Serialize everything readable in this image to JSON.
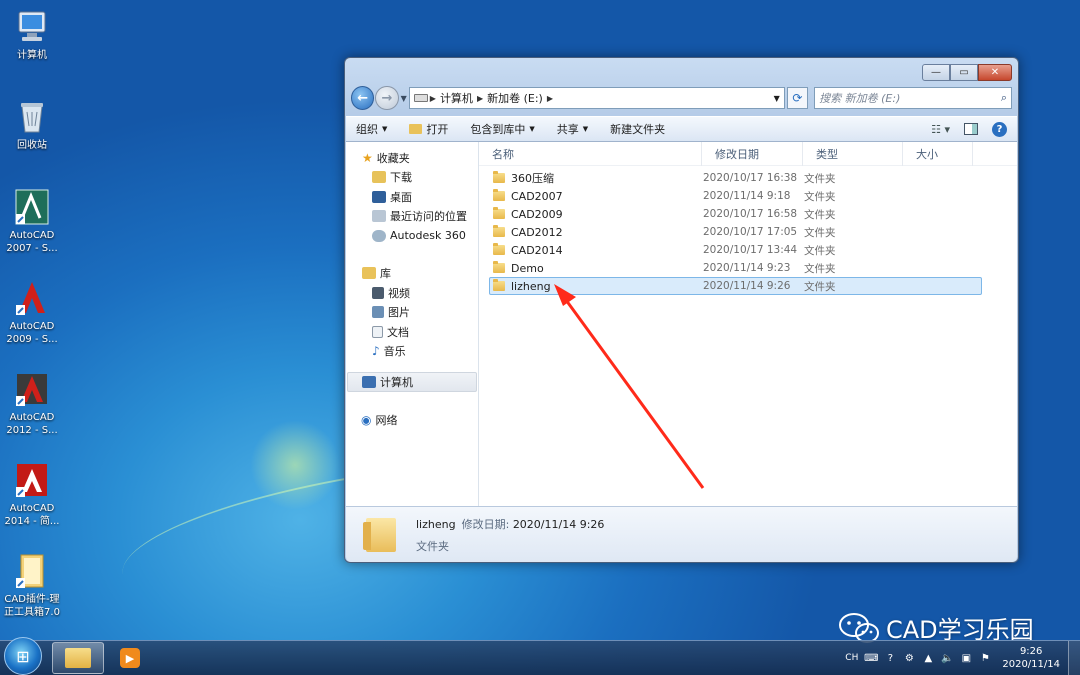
{
  "desktop": {
    "icons": [
      {
        "label": "计算机",
        "icon": "computer-icon"
      },
      {
        "label": "回收站",
        "icon": "recycle-bin-icon"
      },
      {
        "label": "AutoCAD 2007 - S...",
        "icon": "autocad-2007-icon"
      },
      {
        "label": "AutoCAD 2009 - S...",
        "icon": "autocad-2009-icon"
      },
      {
        "label": "AutoCAD 2012 - S...",
        "icon": "autocad-2012-icon"
      },
      {
        "label": "AutoCAD 2014 - 简...",
        "icon": "autocad-2014-icon"
      },
      {
        "label": "CAD插件-理正工具箱7.0",
        "icon": "cad-plugin-icon"
      }
    ]
  },
  "window": {
    "caption": {
      "minimize": "—",
      "maximize": "▭",
      "close": "✕"
    },
    "address": {
      "segments": [
        "计算机",
        "新加卷 (E:)"
      ]
    },
    "search": {
      "placeholder": "搜索 新加卷 (E:)"
    },
    "toolbar": {
      "organize": "组织",
      "open": "打开",
      "include": "包含到库中",
      "share": "共享",
      "new_folder": "新建文件夹"
    },
    "nav": {
      "favorites": "收藏夹",
      "favorites_items": [
        "下载",
        "桌面",
        "最近访问的位置",
        "Autodesk 360"
      ],
      "libraries": "库",
      "libraries_items": [
        "视频",
        "图片",
        "文档",
        "音乐"
      ],
      "computer": "计算机",
      "network": "网络"
    },
    "columns": {
      "name": "名称",
      "date": "修改日期",
      "type": "类型",
      "size": "大小"
    },
    "files": [
      {
        "name": "360压缩",
        "date": "2020/10/17 16:38",
        "type": "文件夹"
      },
      {
        "name": "CAD2007",
        "date": "2020/11/14 9:18",
        "type": "文件夹"
      },
      {
        "name": "CAD2009",
        "date": "2020/10/17 16:58",
        "type": "文件夹"
      },
      {
        "name": "CAD2012",
        "date": "2020/10/17 17:05",
        "type": "文件夹"
      },
      {
        "name": "CAD2014",
        "date": "2020/10/17 13:44",
        "type": "文件夹"
      },
      {
        "name": "Demo",
        "date": "2020/11/14 9:23",
        "type": "文件夹"
      },
      {
        "name": "lizheng",
        "date": "2020/11/14 9:26",
        "type": "文件夹",
        "selected": true
      }
    ],
    "details": {
      "name": "lizheng",
      "date_label": "修改日期:",
      "date": "2020/11/14 9:26",
      "type": "文件夹"
    }
  },
  "taskbar": {
    "tray": {
      "lang": "CH",
      "time": "9:26",
      "date": "2020/11/14"
    }
  },
  "watermark": {
    "text": "CAD学习乐园"
  },
  "colors": {
    "arrow": "#ff2a1a",
    "selection": "#d9ebfb",
    "desktop": "#1b6fc0"
  }
}
